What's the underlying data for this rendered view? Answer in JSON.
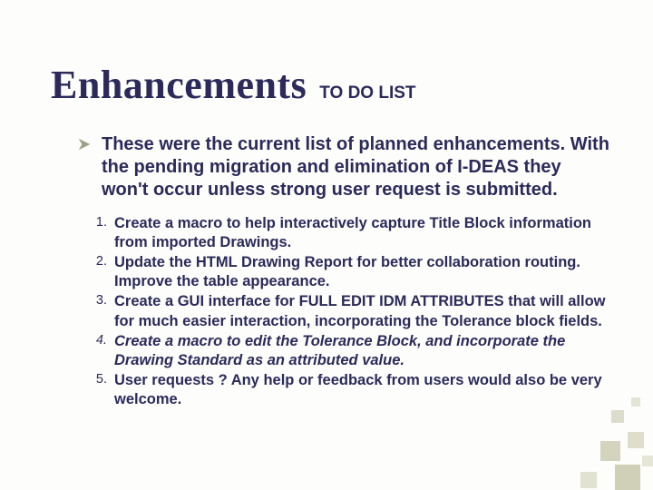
{
  "title": {
    "main": "Enhancements",
    "sub": "TO DO LIST"
  },
  "bullet": "These were the current list of planned enhancements. With the pending migration and elimination of I-DEAS they won't occur unless strong user request is submitted.",
  "items": [
    {
      "n": "1.",
      "text": "Create a macro to help interactively capture Title Block information from imported Drawings.",
      "italic": false
    },
    {
      "n": "2.",
      "text": "Update the HTML Drawing Report for better collaboration routing. Improve the table appearance.",
      "italic": false
    },
    {
      "n": "3.",
      "text": "Create a GUI interface for FULL EDIT IDM ATTRIBUTES that will allow for much easier interaction, incorporating the Tolerance block fields.",
      "italic": false
    },
    {
      "n": "4.",
      "text": "Create a macro to edit the Tolerance Block, and incorporate the Drawing Standard as an attributed value.",
      "italic": true
    },
    {
      "n": "5.",
      "text": "User requests ? Any help or feedback from users would also be very welcome.",
      "italic": false
    }
  ]
}
